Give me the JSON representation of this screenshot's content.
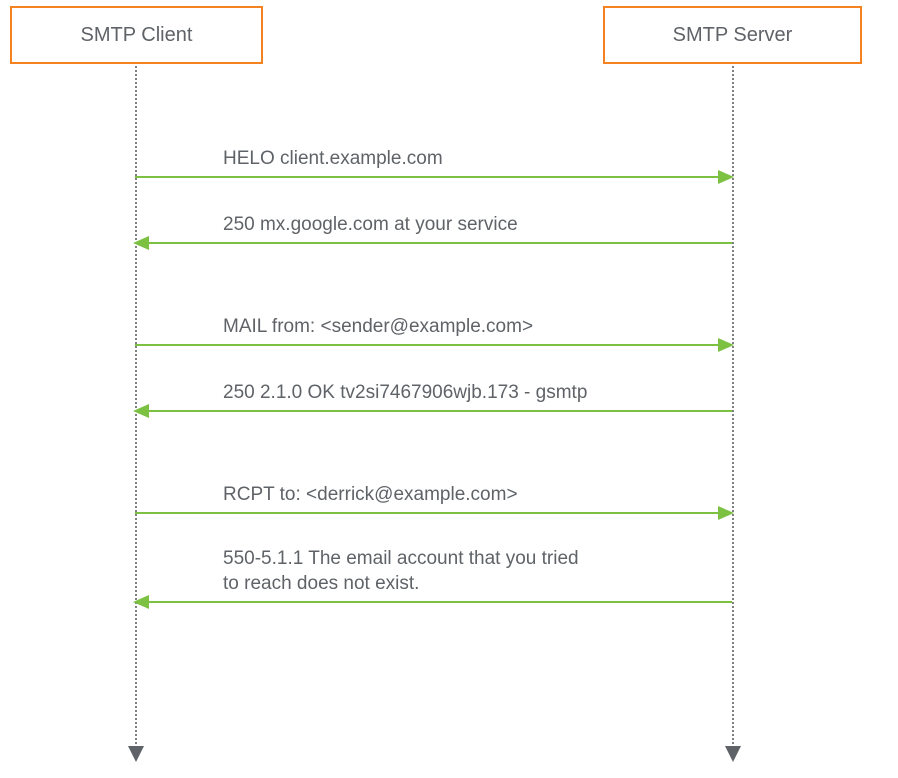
{
  "participants": {
    "client": {
      "label": "SMTP Client"
    },
    "server": {
      "label": "SMTP Server"
    }
  },
  "messages": [
    {
      "text": "HELO client.example.com",
      "direction": "right"
    },
    {
      "text": "250 mx.google.com at your service",
      "direction": "left"
    },
    {
      "text": "MAIL from: <sender@example.com>",
      "direction": "right"
    },
    {
      "text": "250 2.1.0 OK tv2si7467906wjb.173 - gsmtp",
      "direction": "left"
    },
    {
      "text": "RCPT to: <derrick@example.com>",
      "direction": "right"
    },
    {
      "text": "550-5.1.1 The email account that you tried\nto reach does not exist.",
      "direction": "left"
    }
  ],
  "colors": {
    "participant_border": "#f58220",
    "arrow": "#7cc142",
    "text": "#5f6368",
    "lifeline": "#808080"
  }
}
